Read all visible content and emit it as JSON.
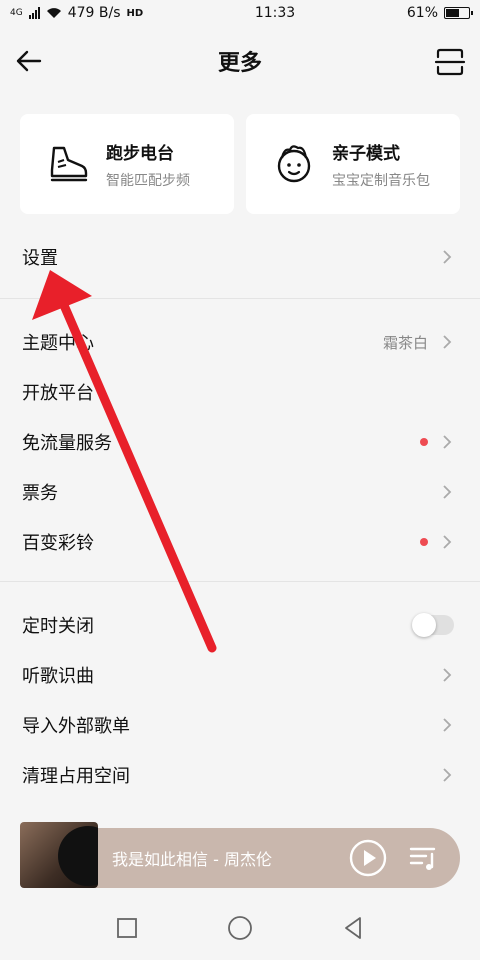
{
  "status_bar": {
    "network": "4G",
    "speed": "479 B/s",
    "hd": "HD",
    "time": "11:33",
    "battery_percent": "61%",
    "battery_level": 0.61
  },
  "header": {
    "title": "更多"
  },
  "cards": [
    {
      "title": "跑步电台",
      "subtitle": "智能匹配步频",
      "icon": "running-shoe-icon"
    },
    {
      "title": "亲子模式",
      "subtitle": "宝宝定制音乐包",
      "icon": "baby-face-icon"
    }
  ],
  "settings": {
    "label": "设置"
  },
  "group1": [
    {
      "label": "主题中心",
      "value": "霜茶白"
    },
    {
      "label": "开放平台"
    },
    {
      "label": "免流量服务",
      "dot": true
    },
    {
      "label": "票务"
    },
    {
      "label": "百变彩铃",
      "dot": true
    }
  ],
  "group2": [
    {
      "label": "定时关闭",
      "toggle": false
    },
    {
      "label": "听歌识曲"
    },
    {
      "label": "导入外部歌单"
    },
    {
      "label": "清理占用空间"
    }
  ],
  "player": {
    "song": "我是如此相信 - 周杰伦"
  },
  "colors": {
    "accent_red": "#ee4b52",
    "player_bg": "#c9b7ad",
    "annotation_arrow": "#e8202a"
  }
}
